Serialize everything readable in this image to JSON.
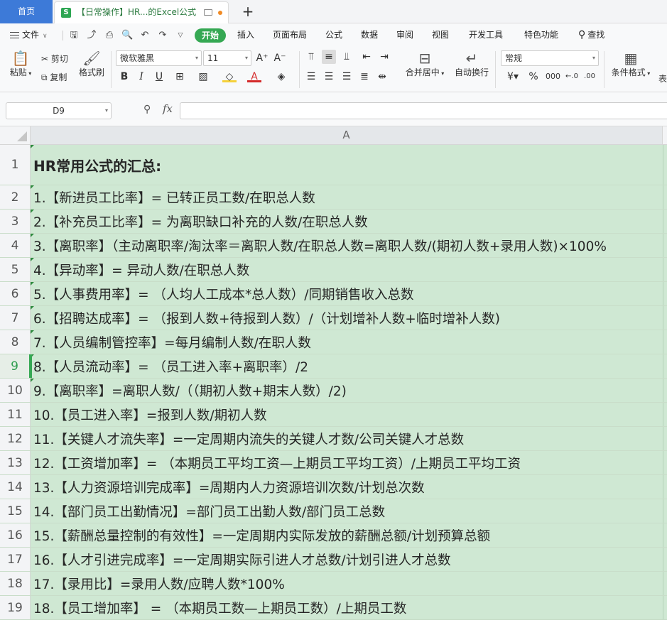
{
  "tabs": {
    "home": "首页",
    "doc_icon": "S",
    "doc_title": "【日常操作】HR...的Excel公式",
    "add": "+"
  },
  "menu": {
    "file": "文件",
    "start": "开始",
    "items": [
      "插入",
      "页面布局",
      "公式",
      "数据",
      "审阅",
      "视图",
      "开发工具",
      "特色功能"
    ],
    "search": "查找"
  },
  "ribbon": {
    "paste": "粘贴",
    "cut": "剪切",
    "copy": "复制",
    "format_painter": "格式刷",
    "font_name": "微软雅黑",
    "font_size": "11",
    "number_format": "常规",
    "merge_center": "合并居中",
    "wrap_text": "自动换行",
    "conditional_format": "条件格式",
    "table_partial": "表"
  },
  "formula_bar": {
    "name_box": "D9",
    "fx": "fx",
    "value": ""
  },
  "sheet": {
    "column_header": "A",
    "active_row": 9,
    "rows": [
      {
        "num": "1",
        "text": "HR常用公式的汇总:"
      },
      {
        "num": "2",
        "text": "1.【新进员工比率】= 已转正员工数/在职总人数"
      },
      {
        "num": "3",
        "text": "2.【补充员工比率】= 为离职缺口补充的人数/在职总人数"
      },
      {
        "num": "4",
        "text": "3.【离职率】（主动离职率/淘汰率＝离职人数/在职总人数=离职人数/(期初人数+录用人数)×100%"
      },
      {
        "num": "5",
        "text": "4.【异动率】= 异动人数/在职总人数"
      },
      {
        "num": "6",
        "text": "5.【人事费用率】= （人均人工成本*总人数）/同期销售收入总数"
      },
      {
        "num": "7",
        "text": "6.【招聘达成率】= （报到人数+待报到人数）/（计划增补人数+临时增补人数)"
      },
      {
        "num": "8",
        "text": "7.【人员编制管控率】=每月编制人数/在职人数"
      },
      {
        "num": "9",
        "text": "8.【人员流动率】= （员工进入率+离职率）/2"
      },
      {
        "num": "10",
        "text": "9.【离职率】=离职人数/（（期初人数+期末人数）/2)"
      },
      {
        "num": "11",
        "text": "10.【员工进入率】=报到人数/期初人数"
      },
      {
        "num": "12",
        "text": "11.【关键人才流失率】=一定周期内流失的关键人才数/公司关键人才总数"
      },
      {
        "num": "13",
        "text": "12.【工资增加率】= （本期员工平均工资—上期员工平均工资）/上期员工平均工资"
      },
      {
        "num": "14",
        "text": "13.【人力资源培训完成率】=周期内人力资源培训次数/计划总次数"
      },
      {
        "num": "15",
        "text": "14.【部门员工出勤情况】=部门员工出勤人数/部门员工总数"
      },
      {
        "num": "16",
        "text": "15.【薪酬总量控制的有效性】=一定周期内实际发放的薪酬总额/计划预算总额"
      },
      {
        "num": "17",
        "text": "16.【人才引进完成率】=一定周期实际引进人才总数/计划引进人才总数"
      },
      {
        "num": "18",
        "text": "17.【录用比】=录用人数/应聘人数*100%"
      },
      {
        "num": "19",
        "text": "18.【员工增加率】 = （本期员工数—上期员工数）/上期员工数"
      }
    ]
  }
}
